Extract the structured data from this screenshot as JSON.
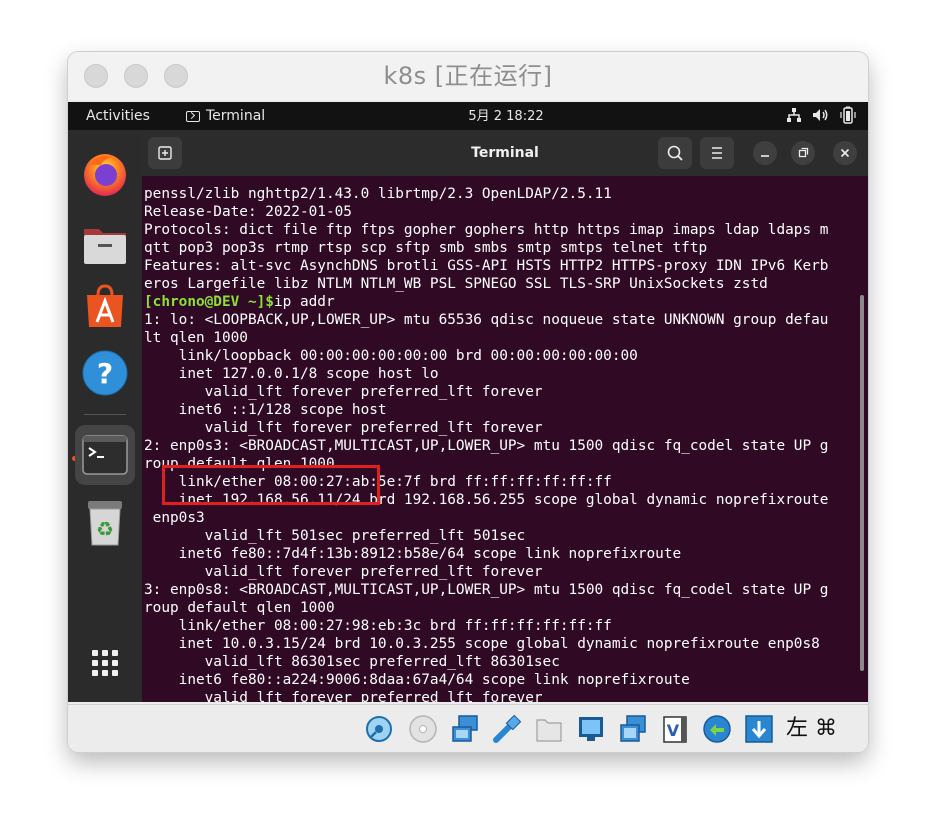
{
  "vm_window": {
    "title": "k8s [正在运行]"
  },
  "gnome": {
    "activities_label": "Activities",
    "app_menu_label": "Terminal",
    "clock": "5月 2  18:22",
    "tray_icons": [
      "network-icon",
      "volume-icon",
      "battery-icon"
    ]
  },
  "dock": {
    "items": [
      {
        "name": "firefox",
        "icon": "firefox-icon"
      },
      {
        "name": "files",
        "icon": "files-icon"
      },
      {
        "name": "software",
        "icon": "app-store-icon"
      },
      {
        "name": "help",
        "icon": "help-icon"
      },
      {
        "name": "terminal",
        "icon": "terminal-icon",
        "active": true
      },
      {
        "name": "trash",
        "icon": "trash-icon"
      },
      {
        "name": "show-apps",
        "icon": "app-grid-icon"
      }
    ]
  },
  "terminal": {
    "title": "Terminal",
    "prompt": "[chrono@DEV ~]$",
    "command": "ip addr",
    "lines_before": [
      "penssl/zlib nghttp2/1.43.0 librtmp/2.3 OpenLDAP/2.5.11",
      "Release-Date: 2022-01-05",
      "Protocols: dict file ftp ftps gopher gophers http https imap imaps ldap ldaps m",
      "qtt pop3 pop3s rtmp rtsp scp sftp smb smbs smtp smtps telnet tftp",
      "Features: alt-svc AsynchDNS brotli GSS-API HSTS HTTP2 HTTPS-proxy IDN IPv6 Kerb",
      "eros Largefile libz NTLM NTLM_WB PSL SPNEGO SSL TLS-SRP UnixSockets zstd"
    ],
    "lines_after": [
      "1: lo: <LOOPBACK,UP,LOWER_UP> mtu 65536 qdisc noqueue state UNKNOWN group defau",
      "lt qlen 1000",
      "    link/loopback 00:00:00:00:00:00 brd 00:00:00:00:00:00",
      "    inet 127.0.0.1/8 scope host lo",
      "       valid_lft forever preferred_lft forever",
      "    inet6 ::1/128 scope host",
      "       valid_lft forever preferred_lft forever",
      "2: enp0s3: <BROADCAST,MULTICAST,UP,LOWER_UP> mtu 1500 qdisc fq_codel state UP g",
      "roup default qlen 1000",
      "    link/ether 08:00:27:ab:5e:7f brd ff:ff:ff:ff:ff:ff",
      "    inet 192.168.56.11/24 brd 192.168.56.255 scope global dynamic noprefixroute",
      " enp0s3",
      "       valid_lft 501sec preferred_lft 501sec",
      "    inet6 fe80::7d4f:13b:8912:b58e/64 scope link noprefixroute",
      "       valid_lft forever preferred_lft forever",
      "3: enp0s8: <BROADCAST,MULTICAST,UP,LOWER_UP> mtu 1500 qdisc fq_codel state UP g",
      "roup default qlen 1000",
      "    link/ether 08:00:27:98:eb:3c brd ff:ff:ff:ff:ff:ff",
      "    inet 10.0.3.15/24 brd 10.0.3.255 scope global dynamic noprefixroute enp0s8",
      "       valid_lft 86301sec preferred_lft 86301sec",
      "    inet6 fe80::a224:9006:8daa:67a4/64 scope link noprefixroute",
      "       valid_lft forever preferred_lft forever"
    ],
    "highlight_color": "#e02020"
  },
  "status_bar": {
    "icons": [
      "hard-disk-icon",
      "optical-disk-icon",
      "network-adapter-icon",
      "usb-icon",
      "shared-folder-icon",
      "display-icon",
      "video-capture-icon",
      "vrde-icon",
      "recording-icon",
      "arrow-down-icon"
    ],
    "host_key_label": "左 ⌘"
  },
  "colors": {
    "terminal_bg": "#300a24",
    "prompt": "#8ae234",
    "accent": "#e95420"
  }
}
